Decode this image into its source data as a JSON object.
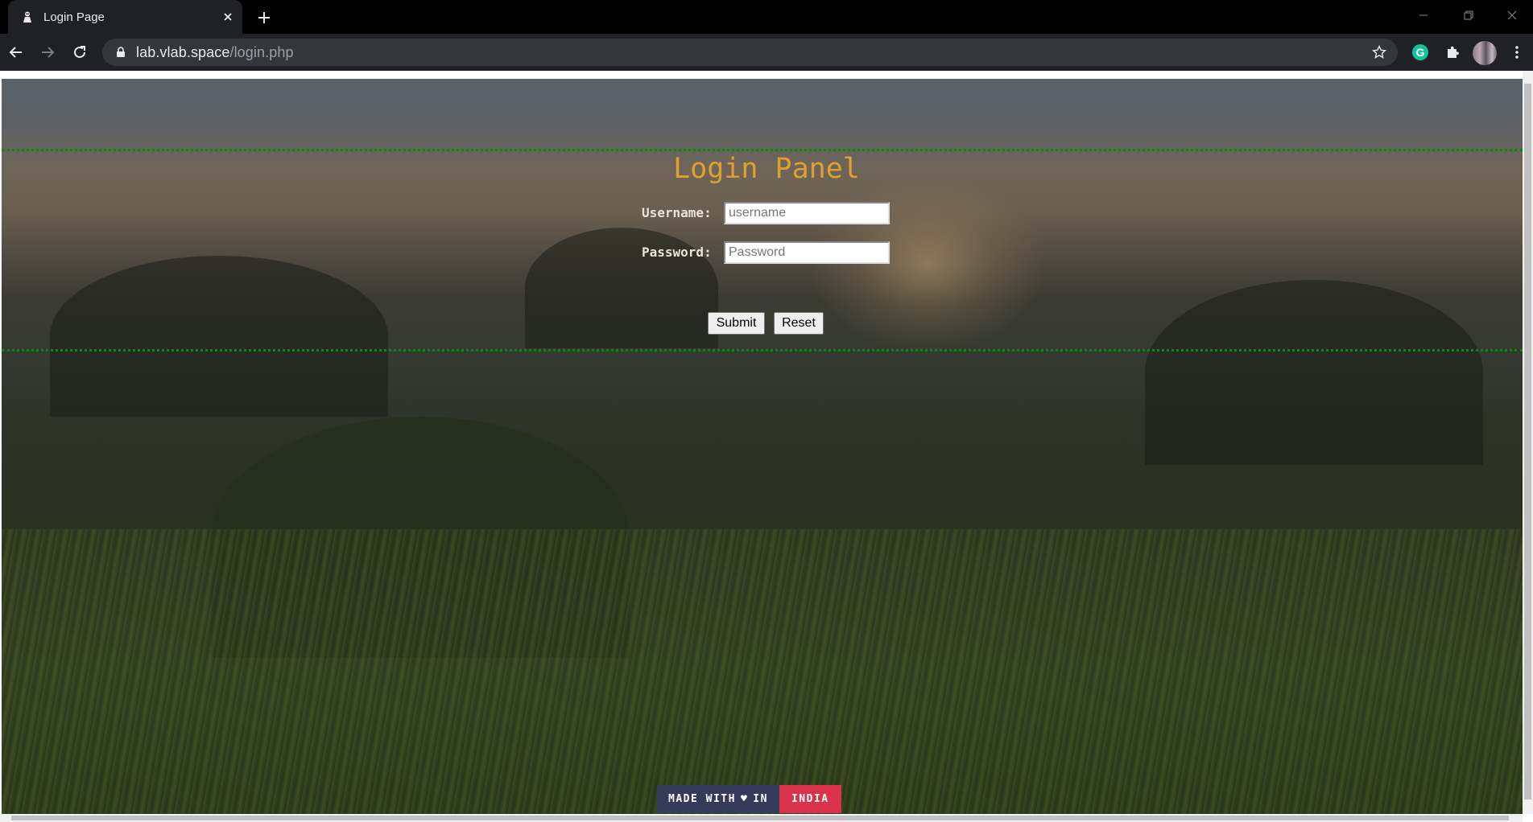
{
  "browser": {
    "tab_title": "Login Page",
    "url_host": "lab.vlab.space",
    "url_path": "/login.php"
  },
  "page": {
    "title": "Login Panel",
    "username_label": "Username:",
    "username_placeholder": "username",
    "password_label": "Password:",
    "password_placeholder": "Password",
    "submit_label": "Submit",
    "reset_label": "Reset",
    "badge_left": "MADE WITH",
    "badge_heart": "♥",
    "badge_in": "IN",
    "badge_right": "INDIA"
  },
  "colors": {
    "title": "#e0a030",
    "dotted_border": "#0a8a0a",
    "badge_left_bg": "#333a5a",
    "badge_right_bg": "#d9324a"
  }
}
